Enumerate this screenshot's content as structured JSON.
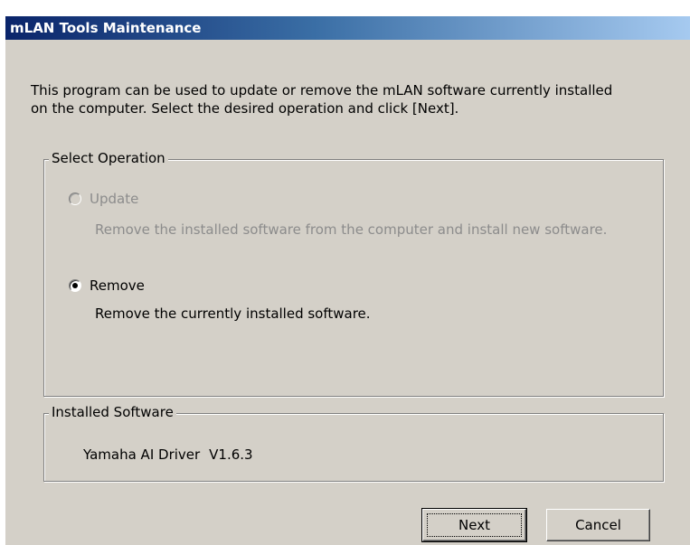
{
  "window": {
    "title": "mLAN Tools Maintenance"
  },
  "intro": {
    "line1": "This program can be used to update or remove the mLAN software currently installed",
    "line2": "on the computer. Select the desired operation and click [Next]."
  },
  "operation": {
    "legend": "Select Operation",
    "options": [
      {
        "label": "Update",
        "description": "Remove the installed software from the computer and install new software.",
        "selected": false,
        "enabled": false
      },
      {
        "label": "Remove",
        "description": "Remove the currently installed software.",
        "selected": true,
        "enabled": true
      }
    ]
  },
  "installed": {
    "legend": "Installed Software",
    "name": "Yamaha AI Driver",
    "version": "V1.6.3"
  },
  "buttons": {
    "next": "Next",
    "cancel": "Cancel"
  }
}
